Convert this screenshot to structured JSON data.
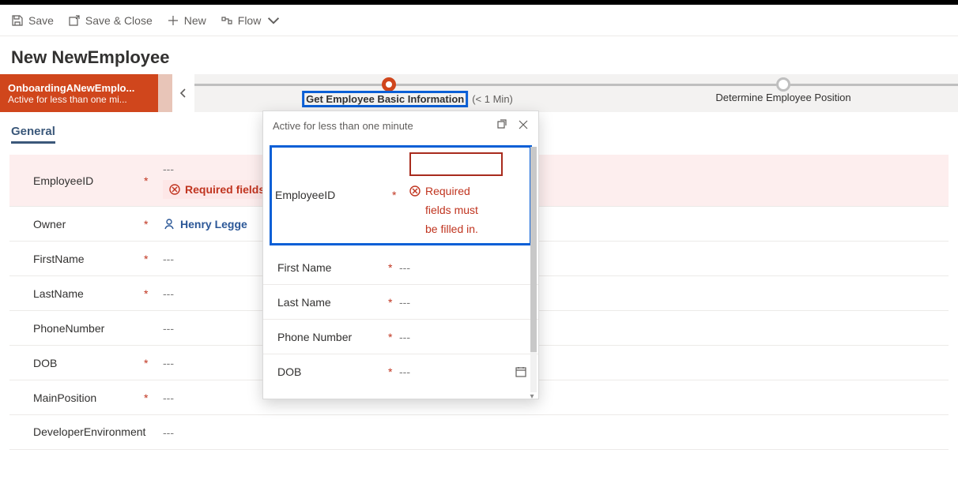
{
  "commands": {
    "save": "Save",
    "saveClose": "Save & Close",
    "new": "New",
    "flow": "Flow"
  },
  "pageTitle": "New NewEmployee",
  "bpf": {
    "name": "OnboardingANewEmplo...",
    "status": "Active for less than one mi...",
    "stage1": {
      "name": "Get Employee Basic Information",
      "duration": "(< 1 Min)"
    },
    "stage2": {
      "name": "Determine Employee Position"
    }
  },
  "tabs": {
    "general": "General"
  },
  "form": {
    "dash": "---",
    "employeeId": {
      "label": "EmployeeID",
      "error": "Required fields"
    },
    "owner": {
      "label": "Owner",
      "value": "Henry Legge"
    },
    "firstName": {
      "label": "FirstName"
    },
    "lastName": {
      "label": "LastName"
    },
    "phone": {
      "label": "PhoneNumber"
    },
    "dob": {
      "label": "DOB"
    },
    "mainPosition": {
      "label": "MainPosition"
    },
    "devEnv": {
      "label": "DeveloperEnvironment"
    }
  },
  "flyout": {
    "status": "Active for less than one minute",
    "employeeId": {
      "label": "EmployeeID",
      "err1": "Required",
      "err2": "fields must",
      "err3": "be filled in."
    },
    "firstName": {
      "label": "First Name"
    },
    "lastName": {
      "label": "Last Name"
    },
    "phone": {
      "label": "Phone Number"
    },
    "dob": {
      "label": "DOB"
    }
  },
  "req": "*"
}
